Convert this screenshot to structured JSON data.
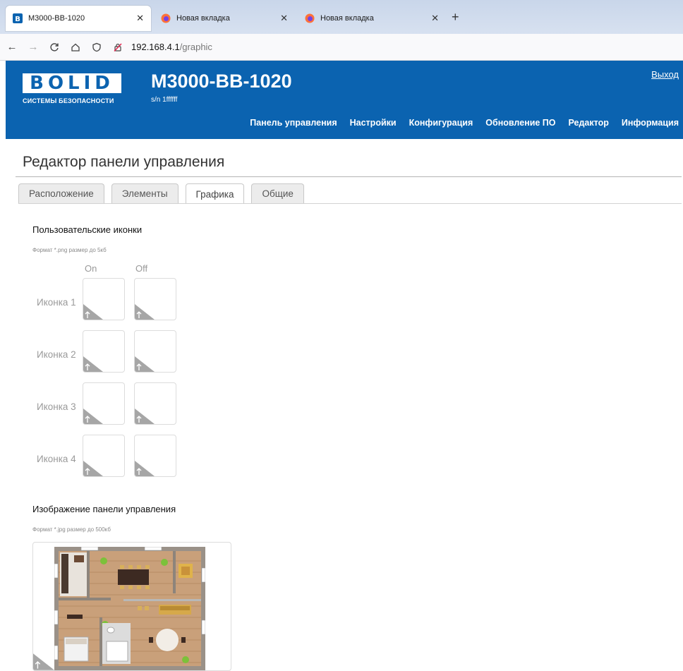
{
  "browser": {
    "tabs": [
      {
        "title": "M3000-BB-1020",
        "active": true
      },
      {
        "title": "Новая вкладка",
        "active": false
      },
      {
        "title": "Новая вкладка",
        "active": false
      }
    ],
    "url_host": "192.168.4.1",
    "url_path": "/graphic"
  },
  "header": {
    "logo_word": "BOLID",
    "logo_sub": "СИСТЕМЫ БЕЗОПАСНОСТИ",
    "device_title": "M3000-BB-1020",
    "serial": "s/n 1ffffff",
    "logout": "Выход",
    "nav": [
      "Панель управления",
      "Настройки",
      "Конфигурация",
      "Обновление ПО",
      "Редактор",
      "Информация"
    ]
  },
  "page": {
    "title": "Редактор панели управления",
    "tabs": [
      "Расположение",
      "Элементы",
      "Графика",
      "Общие"
    ],
    "active_tab": "Графика"
  },
  "icons_section": {
    "title": "Пользовательские иконки",
    "hint": "Формат *.png размер до 5кб",
    "col_on": "On",
    "col_off": "Off",
    "rows": [
      "Иконка 1",
      "Иконка 2",
      "Иконка 3",
      "Иконка 4"
    ]
  },
  "panel_section": {
    "title": "Изображение панели управления",
    "hint": "Формат *.jpg размер до 500кб"
  },
  "colors": {
    "brand_blue": "#0b63b0",
    "tab_bg": "#ececec"
  }
}
